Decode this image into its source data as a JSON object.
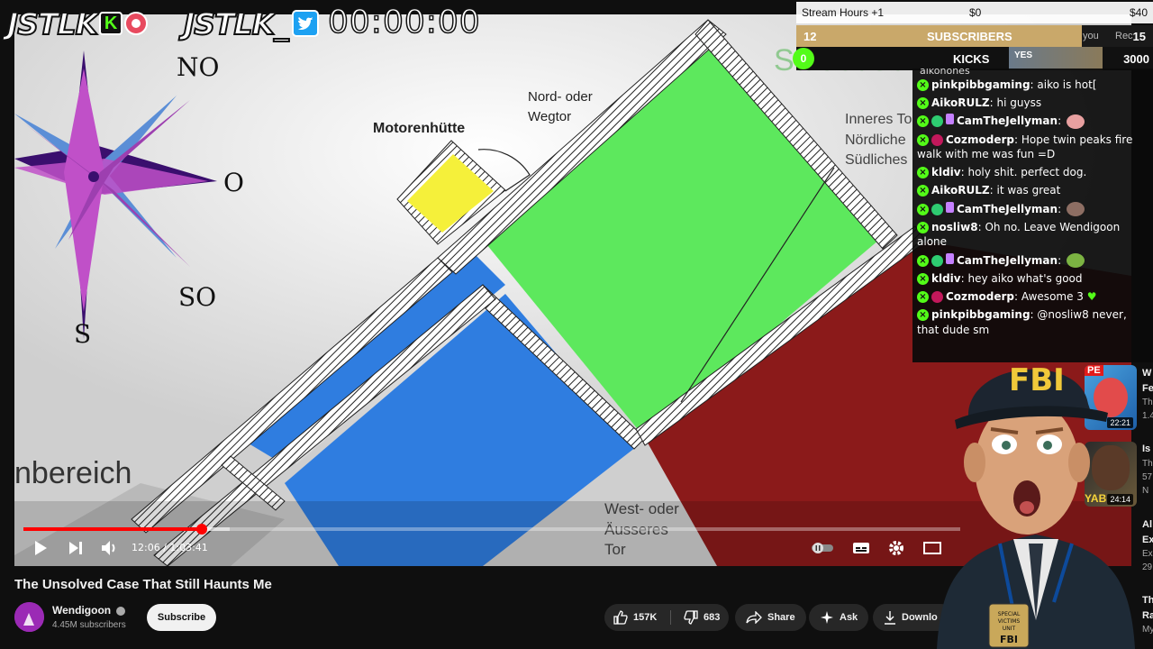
{
  "overlay": {
    "brand_left": "JSTLK",
    "kick_badge": "K",
    "brand_right": "JSTLK_",
    "stream_timer": "00:00:00",
    "goals": {
      "stream_hours_label": "Stream Hours +1",
      "amount_current": "$0",
      "amount_goal": "$40",
      "subscribers_count": "12",
      "subscribers_label": "SUBSCRIBERS",
      "subscribers_goal": "15",
      "subscribers_progress": 0.8,
      "kicks_count": "0",
      "kicks_label": "KICKS",
      "kicks_goal": "3000",
      "kicks_progress": 0.0,
      "obscured_right_1": "you",
      "obscured_right_2": "Rec",
      "thumb_text": "YES"
    }
  },
  "video": {
    "diagram_labels": {
      "compass_no": "NO",
      "compass_o": "O",
      "compass_so": "SO",
      "compass_s": "S",
      "motorenhuette": "Motorenhütte",
      "nord_tor_1": "Nord- oder",
      "nord_tor_2": "Wegtor",
      "stadel": "Stadel/Scheu",
      "inneres_1": "Inneres To",
      "inneres_2": "Nördliche",
      "inneres_3": "Südliches",
      "bereich": "nbereich",
      "west_1": "West- oder",
      "west_2": "Äusseres",
      "west_3": "Tor"
    },
    "player": {
      "current_time": "12:06",
      "duration": "1:03:41",
      "time_display": "12:06 / 1:03:41",
      "progress": 0.19,
      "buffered": 0.22
    }
  },
  "chat": {
    "partial_top": "aikohones",
    "messages": [
      {
        "user": "pinkpibbgaming",
        "color": "#ffffff",
        "text": "aiko is hot[",
        "sub": false,
        "gift": false
      },
      {
        "user": "AikoRULZ",
        "color": "#ffffff",
        "text": "hi guyss",
        "sub": false,
        "gift": false
      },
      {
        "user": "CamTheJellyman",
        "color": "#ffffff",
        "text": "",
        "sub": true,
        "subColor": "#2ecc71",
        "gift": true,
        "emote": "#e8a0a0"
      },
      {
        "user": "Cozmoderp",
        "color": "#ffffff",
        "text": "Hope twin peaks fire walk with me was fun =D",
        "sub": true,
        "subColor": "#c2185b",
        "gift": false
      },
      {
        "user": "kldiv",
        "color": "#ffffff",
        "text": "holy shit. perfect dog.",
        "sub": false,
        "gift": false
      },
      {
        "user": "AikoRULZ",
        "color": "#ffffff",
        "text": "it was great",
        "sub": false,
        "gift": false
      },
      {
        "user": "CamTheJellyman",
        "color": "#ffffff",
        "text": "",
        "sub": true,
        "subColor": "#2ecc71",
        "gift": true,
        "emote": "#8d6e63"
      },
      {
        "user": "nosliw8",
        "color": "#ffffff",
        "text": "Oh no. Leave Wendigoon alone",
        "sub": false,
        "gift": false
      },
      {
        "user": "CamTheJellyman",
        "color": "#ffffff",
        "text": "",
        "sub": true,
        "subColor": "#2ecc71",
        "gift": true,
        "emote": "#7cb342"
      },
      {
        "user": "kldiv",
        "color": "#ffffff",
        "text": "hey aiko what's good",
        "sub": false,
        "gift": false
      },
      {
        "user": "Cozmoderp",
        "color": "#ffffff",
        "text": "Awesome 3",
        "sub": true,
        "subColor": "#c2185b",
        "gift": false,
        "heart": true
      },
      {
        "user": "pinkpibbgaming",
        "color": "#ffffff",
        "text": "@nosliw8 never, that dude sm",
        "sub": false,
        "gift": false
      }
    ]
  },
  "sidebar": {
    "items": [
      {
        "duration": "22:21",
        "line1": "W",
        "line2": "Fe",
        "line3": "Th",
        "line4": "1.4",
        "tag": "PE"
      },
      {
        "duration": "24:14",
        "line1": "Is",
        "line2": "",
        "line3": "Th",
        "line4": "57",
        "line5": "N",
        "tag": "YAB"
      }
    ],
    "partial": [
      "Al",
      "Ex",
      "Ex",
      "29",
      "Th",
      "Ra",
      "My"
    ]
  },
  "below_video": {
    "title": "The Unsolved Case That Still Haunts Me",
    "channel_name": "Wendigoon",
    "subscribers": "4.45M subscribers",
    "subscribe_label": "Subscribe",
    "likes": "157K",
    "dislikes": "683",
    "share_label": "Share",
    "ask_label": "Ask",
    "download_label": "Downlo"
  },
  "cam": {
    "hat_text": "FBI",
    "badge_line1": "SPECIAL",
    "badge_line2": "VICTIMS",
    "badge_line3": "UNIT",
    "badge_line4": "FBI"
  },
  "colors": {
    "green_area": "#5de85d",
    "blue_area": "#2f7de0",
    "red_area": "#8b1a1a",
    "yellow_hut": "#f5f03a",
    "progress": "#ff0000",
    "kick_green": "#53fc18"
  }
}
